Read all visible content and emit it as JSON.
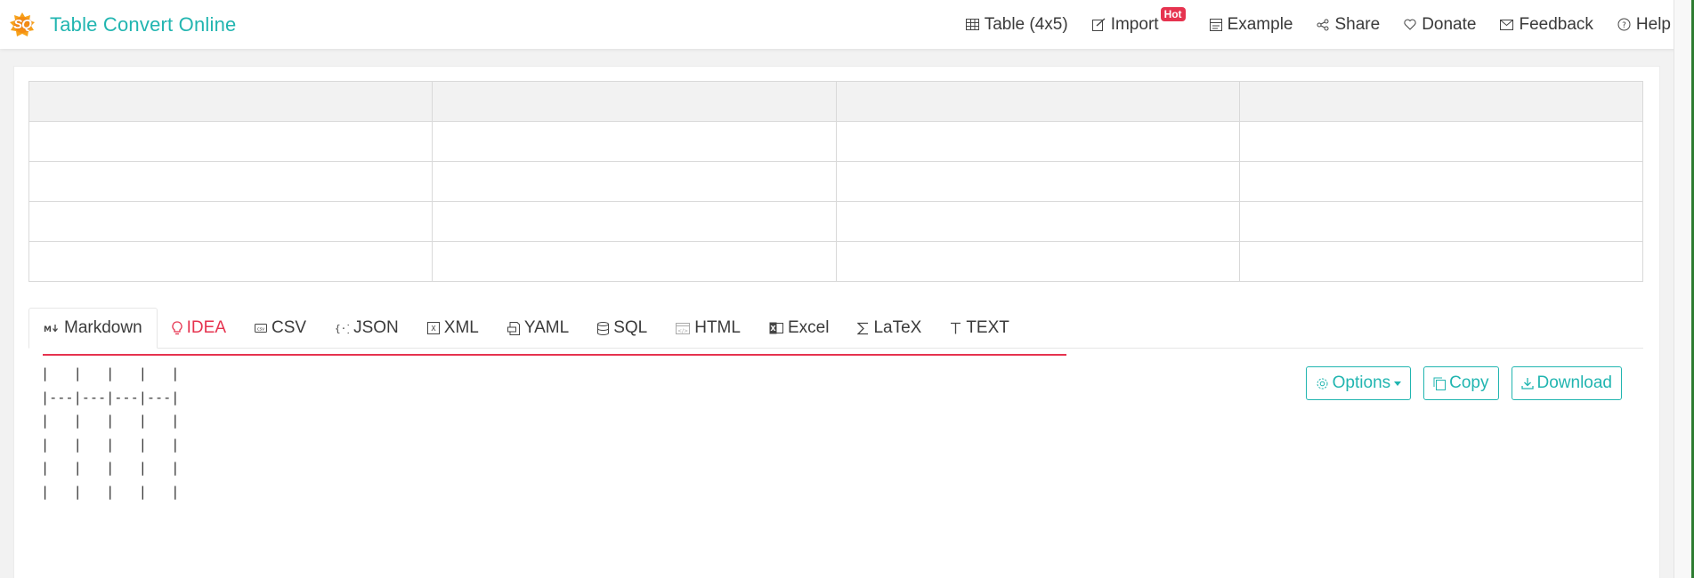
{
  "app": {
    "logo_text": "SQ",
    "title": "Table Convert Online"
  },
  "menu": {
    "table": "Table (4x5)",
    "import": "Import",
    "import_badge": "Hot",
    "example": "Example",
    "share": "Share",
    "donate": "Donate",
    "feedback": "Feedback",
    "help": "Help"
  },
  "grid": {
    "columns": 4,
    "rows": 5,
    "header": [
      "",
      "",
      "",
      ""
    ],
    "cells": [
      [
        "",
        "",
        "",
        ""
      ],
      [
        "",
        "",
        "",
        ""
      ],
      [
        "",
        "",
        "",
        ""
      ],
      [
        "",
        "",
        "",
        ""
      ]
    ]
  },
  "tabs": [
    {
      "id": "markdown",
      "label": "Markdown",
      "icon": "markdown-icon"
    },
    {
      "id": "idea",
      "label": "IDEA",
      "icon": "lightbulb-icon"
    },
    {
      "id": "csv",
      "label": "CSV",
      "icon": "csv-icon"
    },
    {
      "id": "json",
      "label": "JSON",
      "icon": "braces-icon"
    },
    {
      "id": "xml",
      "label": "XML",
      "icon": "xml-icon"
    },
    {
      "id": "yaml",
      "label": "YAML",
      "icon": "yaml-icon"
    },
    {
      "id": "sql",
      "label": "SQL",
      "icon": "database-icon"
    },
    {
      "id": "html",
      "label": "HTML",
      "icon": "html-icon"
    },
    {
      "id": "excel",
      "label": "Excel",
      "icon": "excel-icon"
    },
    {
      "id": "latex",
      "label": "LaTeX",
      "icon": "sigma-icon"
    },
    {
      "id": "text",
      "label": "TEXT",
      "icon": "text-icon"
    }
  ],
  "active_tab": "Markdown",
  "output": {
    "text": "|   |   |   |   |\n|---|---|---|---|\n|   |   |   |   |\n|   |   |   |   |\n|   |   |   |   |\n|   |   |   |   |"
  },
  "actions": {
    "options": "Options",
    "copy": "Copy",
    "download": "Download"
  },
  "colors": {
    "brand": "#21b5b0",
    "accent_red": "#e6334f",
    "header_cell": "#f2f2f2",
    "border": "#d9d9d9"
  }
}
